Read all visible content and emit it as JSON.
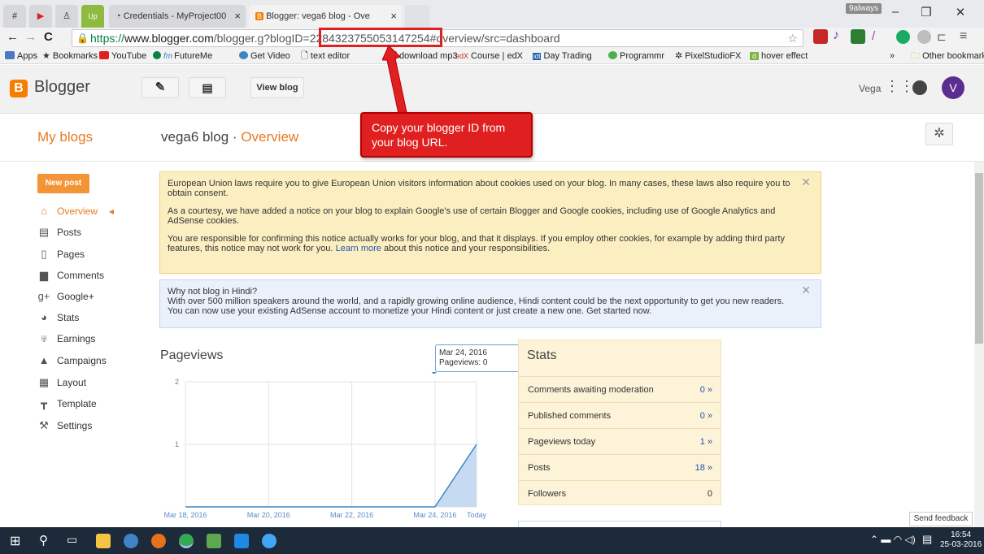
{
  "browser": {
    "tabs": [
      {
        "title": "Credentials - MyProject00"
      },
      {
        "title": "Blogger: vega6 blog - Ove"
      }
    ],
    "profile_badge": "9always",
    "url": {
      "scheme": "https://",
      "host": "www.blogger.com",
      "path_before": "/blogger.g?blogID=",
      "blog_id": "2284323755053147254",
      "path_after": "#overview/src=dashboard"
    },
    "bookmarks": [
      "Apps",
      "Bookmarks",
      "YouTube",
      "FutureMe",
      "Get Video",
      "text editor",
      "download mp3",
      "Course | edX",
      "Day Trading",
      "Programmr",
      "PixelStudioFX",
      "hover effect"
    ],
    "other_bookmarks": "Other bookmarks"
  },
  "header": {
    "brand": "Blogger",
    "view_blog": "View blog",
    "user_name": "Vega",
    "avatar_letter": "V"
  },
  "title_row": {
    "my_blogs": "My blogs",
    "blog_name": "vega6 blog",
    "separator": "·",
    "section": "Overview"
  },
  "callout": {
    "text": "Copy your blogger ID from your blog URL."
  },
  "sidebar": {
    "new_post": "New post",
    "items": [
      {
        "label": "Overview",
        "icon": "home-icon"
      },
      {
        "label": "Posts",
        "icon": "posts-icon"
      },
      {
        "label": "Pages",
        "icon": "page-icon"
      },
      {
        "label": "Comments",
        "icon": "comment-icon"
      },
      {
        "label": "Google+",
        "icon": "googleplus-icon"
      },
      {
        "label": "Stats",
        "icon": "stats-icon"
      },
      {
        "label": "Earnings",
        "icon": "trophy-icon"
      },
      {
        "label": "Campaigns",
        "icon": "campaign-icon"
      },
      {
        "label": "Layout",
        "icon": "layout-icon"
      },
      {
        "label": "Template",
        "icon": "template-icon"
      },
      {
        "label": "Settings",
        "icon": "wrench-icon"
      }
    ]
  },
  "notices": {
    "cookie": {
      "p1": "European Union laws require you to give European Union visitors information about cookies used on your blog. In many cases, these laws also require you to obtain consent.",
      "p2": "As a courtesy, we have added a notice on your blog to explain Google's use of certain Blogger and Google cookies, including use of Google Analytics and AdSense cookies.",
      "p3a": "You are responsible for confirming this notice actually works for your blog, and that it displays. If you employ other cookies, for example by adding third party features, this notice may not work for you.",
      "p3_link": "Learn more",
      "p3b": "about this notice and your responsibilities."
    },
    "hindi": {
      "title": "Why not blog in Hindi?",
      "body": "With over 500 million speakers around the world, and a rapidly growing online audience, Hindi content could be the next opportunity to get you new readers. You can now use your existing AdSense account to monetize your Hindi content or just create a new one. Get started now."
    }
  },
  "pageviews": {
    "title": "Pageviews",
    "tooltip_date": "Mar 24, 2016",
    "tooltip_value": "Pageviews: 0"
  },
  "chart_data": {
    "type": "area",
    "x": [
      "Mar 18, 2016",
      "Mar 19, 2016",
      "Mar 20, 2016",
      "Mar 21, 2016",
      "Mar 22, 2016",
      "Mar 23, 2016",
      "Mar 24, 2016",
      "Today"
    ],
    "xticks": [
      "Mar 18, 2016",
      "Mar 20, 2016",
      "Mar 22, 2016",
      "Mar 24, 2016",
      "Today"
    ],
    "values": [
      0,
      0,
      0,
      0,
      0,
      0,
      0,
      1
    ],
    "yticks": [
      0,
      1,
      2
    ],
    "ylim": [
      0,
      2
    ],
    "colors": {
      "line": "#3d85c6",
      "fill": "#c6dbf2"
    }
  },
  "stats": {
    "title": "Stats",
    "rows": [
      {
        "label": "Comments awaiting moderation",
        "value": "0 »"
      },
      {
        "label": "Published comments",
        "value": "0 »"
      },
      {
        "label": "Pageviews today",
        "value": "1 »"
      },
      {
        "label": "Posts",
        "value": "18 »"
      },
      {
        "label": "Followers",
        "value": "0"
      }
    ]
  },
  "send_feedback": "Send feedback",
  "taskbar": {
    "time": "16:54",
    "date": "25-03-2016"
  }
}
